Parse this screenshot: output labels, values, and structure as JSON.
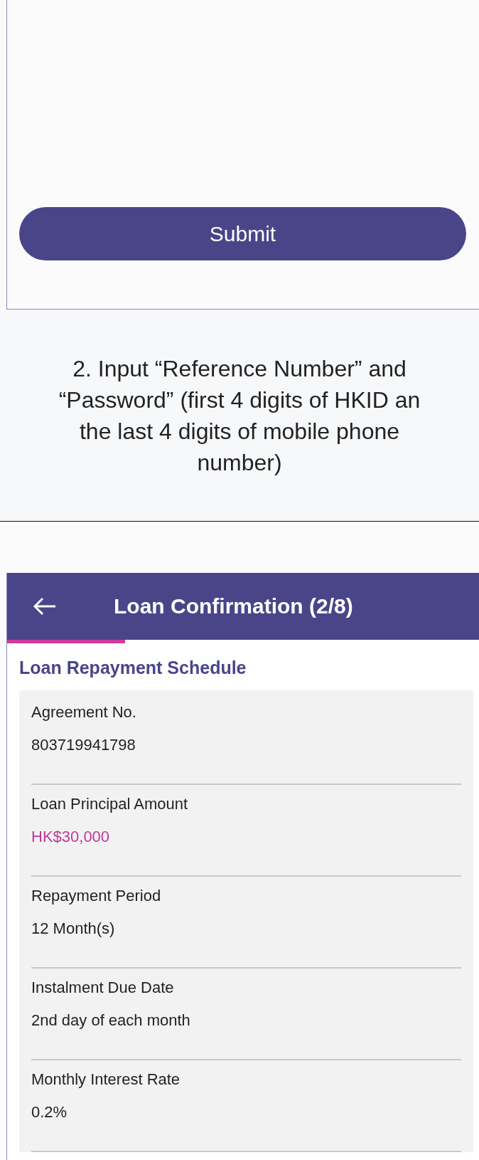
{
  "submit_button": {
    "label": "Submit"
  },
  "caption": [
    "2. Input “Reference Number” and",
    "“Password” (first 4 digits of HKID an",
    "the last 4 digits of mobile phone",
    "number)"
  ],
  "app_header": {
    "title": "Loan Confirmation (2/8)"
  },
  "progress": {
    "level": 0.25
  },
  "section_title": "Loan Repayment Schedule",
  "fields": [
    {
      "label": "Agreement No.",
      "value": "803719941798",
      "emphasis": false
    },
    {
      "label": "Loan Principal Amount",
      "value": "HK$30,000",
      "emphasis": true
    },
    {
      "label": "Repayment Period",
      "value": "12 Month(s)",
      "emphasis": false
    },
    {
      "label": "Instalment Due Date",
      "value": "2nd day of each month",
      "emphasis": false
    },
    {
      "label": "Monthly Interest Rate",
      "value": "0.2%",
      "emphasis": false
    }
  ]
}
